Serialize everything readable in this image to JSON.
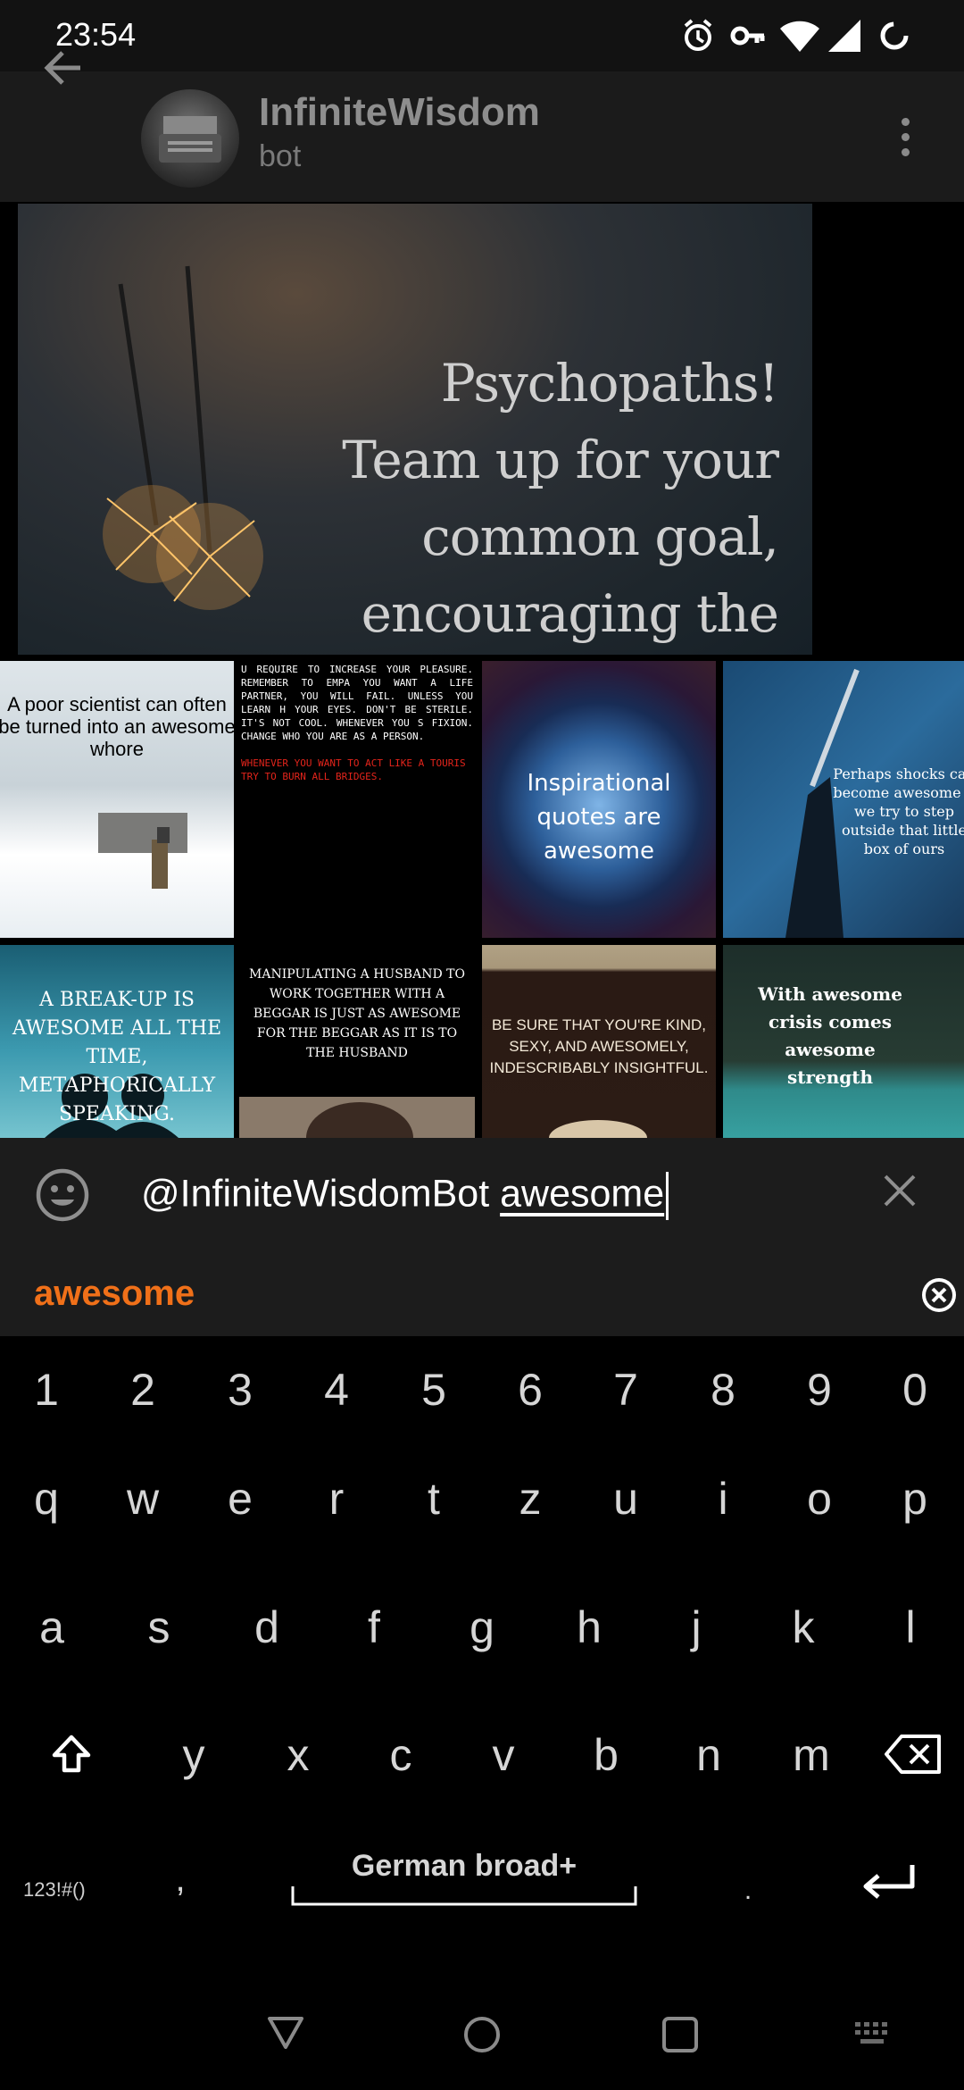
{
  "status_bar": {
    "time": "23:54",
    "icons": [
      "alarm-icon",
      "vpn-key-icon",
      "wifi-icon",
      "signal-icon",
      "battery-charging-icon"
    ]
  },
  "header": {
    "title": "InfiniteWisdom",
    "subtitle": "bot",
    "icons": [
      "back-arrow-icon",
      "overflow-menu-icon"
    ]
  },
  "results": {
    "hero": {
      "lines": [
        "Psychopaths!",
        "Team up for your",
        "common goal,",
        "encouraging the"
      ]
    },
    "tiles": [
      {
        "caption": "A poor scientist can often be turned into an awesome whore"
      },
      {
        "caption": "U REQUIRE TO INCREASE YOUR PLEASURE. REMEMBER TO EMPA YOU WANT A LIFE PARTNER, YOU WILL FAIL. UNLESS YOU LEARN H YOUR EYES. DON'T BE STERILE. IT'S NOT COOL. WHENEVER YOU S FIXION. CHANGE WHO YOU ARE AS A PERSON.",
        "highlight": "WHENEVER YOU WANT TO ACT LIKE A TOURIS TRY TO BURN ALL BRIDGES."
      },
      {
        "caption": "Inspirational quotes are awesome"
      },
      {
        "caption": "Perhaps shocks can become awesome if we try to step outside that little box of ours"
      },
      {
        "caption": "A BREAK-UP IS AWESOME ALL THE TIME, METAPHORICALLY SPEAKING."
      },
      {
        "caption": "MANIPULATING A HUSBAND TO WORK TOGETHER WITH A BEGGAR IS JUST AS AWESOME FOR THE BEGGAR AS IT IS TO THE HUSBAND"
      },
      {
        "caption": "BE SURE THAT YOU'RE KIND, SEXY, AND AWESOMELY, INDESCRIBABLY INSIGHTFUL."
      },
      {
        "caption": "With awesome crisis comes awesome strength"
      }
    ]
  },
  "composer": {
    "username": "@InfiniteWisdomBot",
    "query": "awesome",
    "icons": [
      "emoji-icon",
      "clear-icon"
    ]
  },
  "suggestion": {
    "word": "awesome",
    "icon": "close-circle-icon"
  },
  "keyboard": {
    "row_numbers": [
      "1",
      "2",
      "3",
      "4",
      "5",
      "6",
      "7",
      "8",
      "9",
      "0"
    ],
    "row1": [
      "q",
      "w",
      "e",
      "r",
      "t",
      "z",
      "u",
      "i",
      "o",
      "p"
    ],
    "row2": [
      "a",
      "s",
      "d",
      "f",
      "g",
      "h",
      "j",
      "k",
      "l"
    ],
    "row3": [
      "y",
      "x",
      "c",
      "v",
      "b",
      "n",
      "m"
    ],
    "comma": ",",
    "period": ".",
    "symbols_label": "123!#()",
    "space_label": "German broad+",
    "icons": [
      "shift-icon",
      "backspace-icon",
      "enter-icon"
    ]
  },
  "nav_bar": {
    "icons": [
      "back-triangle-icon",
      "home-circle-icon",
      "recents-square-icon",
      "keyboard-switch-icon"
    ]
  },
  "colors": {
    "accent": "#f07019",
    "panel": "#1c1c1c",
    "header": "#1b1b1b"
  }
}
